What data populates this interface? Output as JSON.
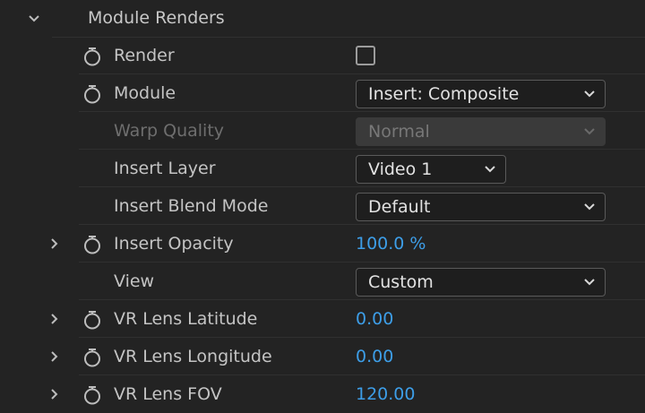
{
  "header": {
    "title": "Module Renders"
  },
  "rows": {
    "render": {
      "label": "Render",
      "checked": false
    },
    "module": {
      "label": "Module",
      "value": "Insert: Composite"
    },
    "warp_quality": {
      "label": "Warp Quality",
      "value": "Normal",
      "disabled": true
    },
    "insert_layer": {
      "label": "Insert Layer",
      "value": "Video 1"
    },
    "insert_blend_mode": {
      "label": "Insert Blend Mode",
      "value": "Default"
    },
    "insert_opacity": {
      "label": "Insert Opacity",
      "value": "100.0 %"
    },
    "view": {
      "label": "View",
      "value": "Custom"
    },
    "vr_lens_latitude": {
      "label": "VR Lens Latitude",
      "value": "0.00"
    },
    "vr_lens_longitude": {
      "label": "VR Lens Longitude",
      "value": "0.00"
    },
    "vr_lens_fov": {
      "label": "VR Lens FOV",
      "value": "120.00"
    }
  },
  "colors": {
    "background": "#232323",
    "value_accent": "#3d9ee8",
    "label": "#c4c4c4",
    "disabled": "#6e6e6e"
  }
}
